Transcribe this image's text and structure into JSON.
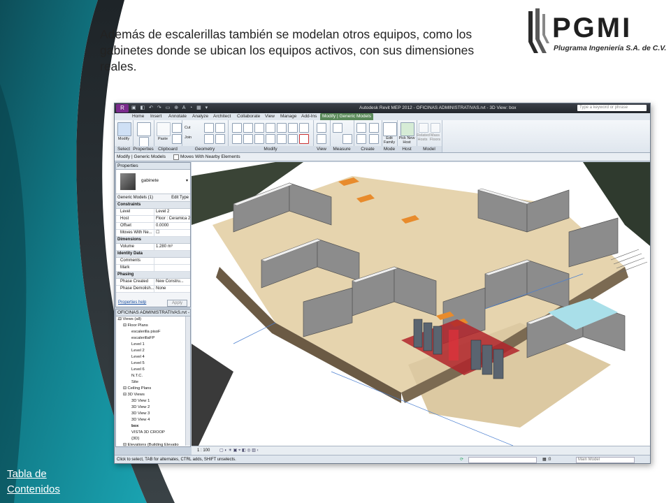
{
  "slide": {
    "caption": "Además de escalerillas también se modelan otros equipos, como los gabinetes donde se ubican los equipos activos, con sus dimensiones reales.",
    "toc_link": "Tabla de Contenidos",
    "logo": {
      "name": "PGMI",
      "subtitle": "Plugrama Ingeniería S.A. de C.V."
    },
    "colors": {
      "teal_dark": "#0f5a66",
      "teal": "#128a98",
      "teal_light": "#1aa6b4",
      "dark": "#2a2f33"
    }
  },
  "revit": {
    "window_title": "Autodesk Revit MEP 2012 -    OFICINAS ADMINISTRATIVAS.rvt - 3D View: box",
    "search_placeholder": "Type a keyword or phrase",
    "tabs": [
      "Home",
      "Insert",
      "Annotate",
      "Analyze",
      "Architect",
      "Collaborate",
      "View",
      "Manage",
      "Add-Ins",
      "Modify | Generic Models"
    ],
    "ribbon_panels": [
      "Select",
      "Properties",
      "Clipboard",
      "Geometry",
      "Modify",
      "View",
      "Measure",
      "Create",
      "Mode",
      "Host",
      "Model"
    ],
    "ribbon_buttons": {
      "modify": "Modify",
      "paste": "Paste",
      "cut": "Cut",
      "join": "Join",
      "edit_family": "Edit Family",
      "pick_new_host": "Pick New Host",
      "related_hosts": "Related Hosts",
      "mass_floors": "Mass Floors"
    },
    "options_bar": {
      "context": "Modify | Generic Models",
      "option": "Moves With Nearby Elements"
    },
    "properties": {
      "header": "Properties",
      "type_name": "gabinete",
      "filter": "Generic Models (1)",
      "edit_type": "Edit Type",
      "groups": {
        "constraints": "Constraints",
        "dimensions": "Dimensions",
        "identity": "Identity Data",
        "phasing": "Phasing"
      },
      "rows": {
        "level": [
          "Level",
          "Level 2"
        ],
        "host": [
          "Host",
          "Floor : Ceramica 2"
        ],
        "offset": [
          "Offset",
          "0.0000"
        ],
        "moves": [
          "Moves With Ne...",
          ""
        ],
        "volume": [
          "Volume",
          "1.280 m³"
        ],
        "comments": [
          "Comments",
          ""
        ],
        "mark": [
          "Mark",
          ""
        ],
        "phase_created": [
          "Phase Created",
          "New Constru..."
        ],
        "phase_demolished": [
          "Phase Demolish...",
          "None"
        ]
      },
      "help": "Properties help",
      "apply": "Apply"
    },
    "browser": {
      "header": "OFICINAS ADMINISTRATIVAS.rvt - ...",
      "items": [
        {
          "label": "Views (all)",
          "level": 0
        },
        {
          "label": "Floor Plans",
          "level": 1
        },
        {
          "label": "escalerilla pisoF",
          "level": 2
        },
        {
          "label": "escalerillaFP",
          "level": 2
        },
        {
          "label": "Level 1",
          "level": 2
        },
        {
          "label": "Level 2",
          "level": 2
        },
        {
          "label": "Level 4",
          "level": 2
        },
        {
          "label": "Level 5",
          "level": 2
        },
        {
          "label": "Level 6",
          "level": 2
        },
        {
          "label": "N.T.C.",
          "level": 2
        },
        {
          "label": "Site",
          "level": 2
        },
        {
          "label": "Ceiling Plans",
          "level": 1
        },
        {
          "label": "3D Views",
          "level": 1
        },
        {
          "label": "3D View 1",
          "level": 2
        },
        {
          "label": "3D View 2",
          "level": 2
        },
        {
          "label": "3D View 3",
          "level": 2
        },
        {
          "label": "3D View 4",
          "level": 2
        },
        {
          "label": "box",
          "level": 2
        },
        {
          "label": "VISTA 3D CROOP",
          "level": 2
        },
        {
          "label": "{3D}",
          "level": 2
        },
        {
          "label": "Elevations (Building Elevatio",
          "level": 1
        }
      ]
    },
    "view_scale": "1 : 100",
    "status_text": "Click to select, TAB for alternates, CTRL adds, SHIFT unselects.",
    "status_model": "Main Model"
  }
}
